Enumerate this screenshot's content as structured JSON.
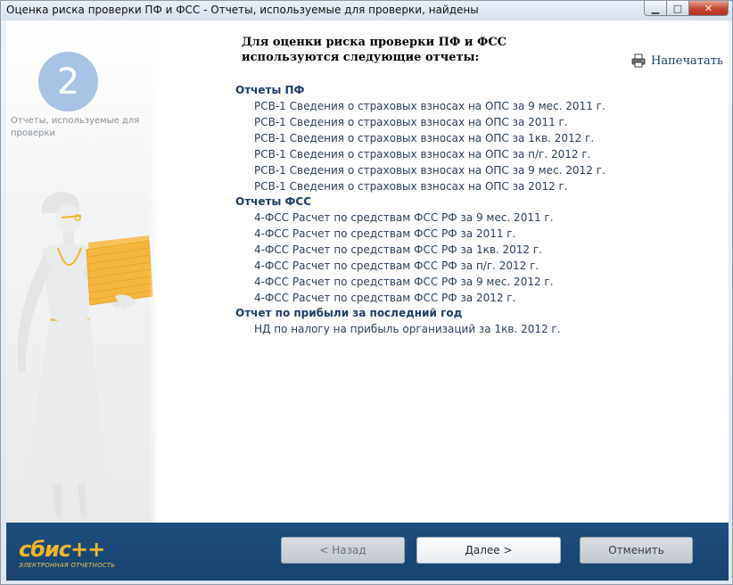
{
  "window": {
    "title": "Оценка риска проверки ПФ и ФСС - Отчеты, используемые для проверки, найдены",
    "min_label": "▁",
    "max_label": "□",
    "close_label": "✕"
  },
  "step": {
    "number": "2",
    "caption": "Отчеты, используемые для проверки"
  },
  "heading": {
    "line1": "Для оценки риска проверки ПФ и ФСС",
    "line2": "используются следующие отчеты:"
  },
  "print": {
    "label": "Напечатать",
    "icon": "printer-icon"
  },
  "groups": [
    {
      "title": "Отчеты ПФ",
      "items": [
        "РСВ-1 Сведения о страховых взносах на ОПС за 9 мес. 2011 г.",
        "РСВ-1 Сведения о страховых взносах на ОПС за 2011 г.",
        "РСВ-1 Сведения о страховых взносах на ОПС за 1кв. 2012 г.",
        "РСВ-1 Сведения о страховых взносах на ОПС за п/г. 2012 г.",
        "РСВ-1 Сведения о страховых взносах на ОПС за 9 мес. 2012 г.",
        "РСВ-1 Сведения о страховых взносах на ОПС за 2012 г."
      ]
    },
    {
      "title": "Отчеты ФСС",
      "items": [
        "4-ФСС Расчет по средствам ФСС РФ за 9 мес. 2011 г.",
        "4-ФСС Расчет по средствам ФСС РФ за 2011 г.",
        "4-ФСС Расчет по средствам ФСС РФ за 1кв. 2012 г.",
        "4-ФСС Расчет по средствам ФСС РФ за п/г. 2012 г.",
        "4-ФСС Расчет по средствам ФСС РФ за 9 мес. 2012 г.",
        "4-ФСС Расчет по средствам ФСС РФ за 2012 г."
      ]
    },
    {
      "title": "Отчет по прибыли за последний год",
      "items": [
        "НД по налогу на прибыль организаций за 1кв. 2012 г."
      ]
    }
  ],
  "logo": {
    "main": "сбис++",
    "sub": "ЭЛЕКТРОННАЯ ОТЧЕТНОСТЬ"
  },
  "buttons": {
    "back": "< Назад",
    "next": "Далее >",
    "cancel": "Отменить"
  },
  "colors": {
    "bottom_bar": "#1b4874",
    "logo": "#f2b52a",
    "step_circle": "#a8c3e3",
    "link": "#1e3e6a",
    "papers": "#f4b63c"
  }
}
